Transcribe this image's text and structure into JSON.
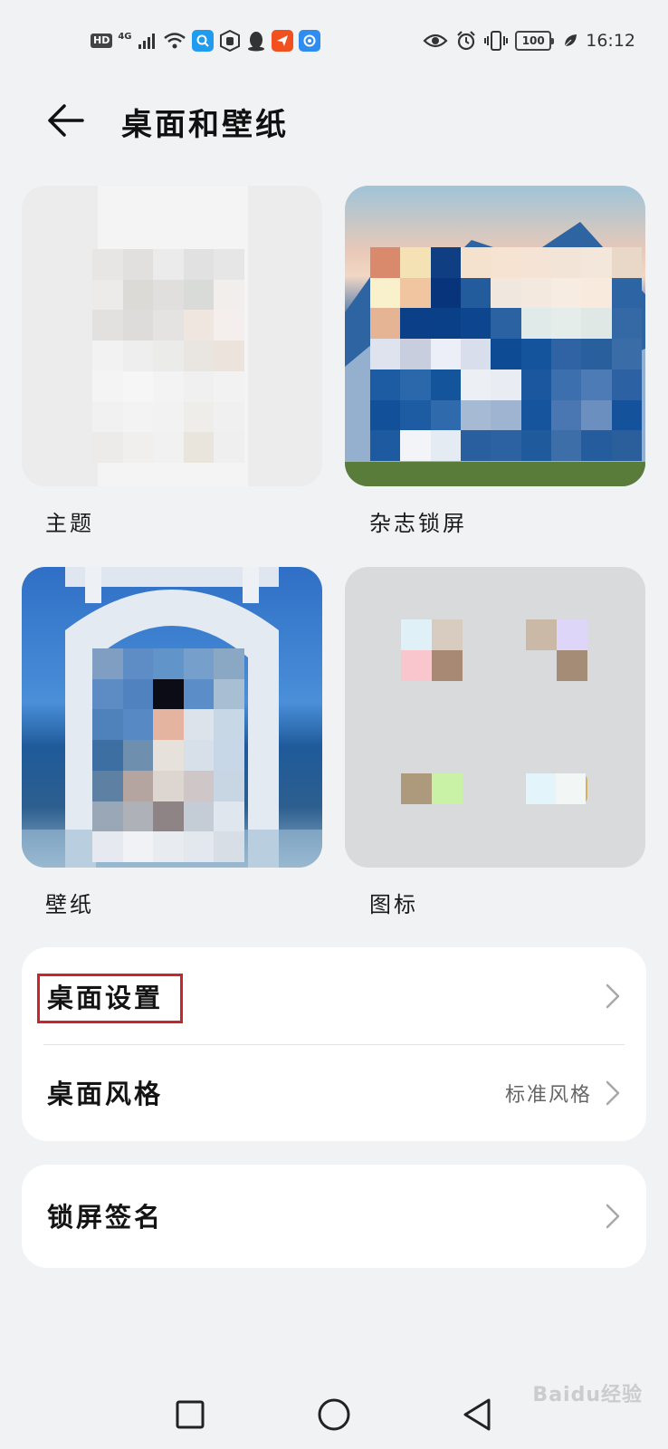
{
  "status_bar": {
    "hd": "HD",
    "network": "4G",
    "battery": "100",
    "time": "16:12",
    "left_icons": [
      "hd-icon",
      "signal-icon",
      "wifi-icon",
      "search-app-icon",
      "hand-app-icon",
      "qq-icon",
      "mail-app-icon",
      "browser-app-icon"
    ],
    "right_icons": [
      "eye-icon",
      "alarm-icon",
      "vibrate-icon",
      "battery-icon",
      "leaf-icon"
    ]
  },
  "header": {
    "title": "桌面和壁纸",
    "back_icon": "arrow-left-icon"
  },
  "tiles": [
    {
      "label": "主题"
    },
    {
      "label": "杂志锁屏"
    },
    {
      "label": "壁纸"
    },
    {
      "label": "图标"
    }
  ],
  "settings": {
    "desktop_settings": "桌面设置",
    "desktop_style": "桌面风格",
    "desktop_style_value": "标准风格",
    "lock_signature": "锁屏签名"
  },
  "nav": {
    "recent_icon": "square-icon",
    "home_icon": "circle-icon",
    "back_icon": "triangle-back-icon"
  },
  "watermark": "Baidu经验",
  "colors": {
    "background": "#f1f2f4",
    "card": "#ffffff",
    "highlight": "#c8262b"
  }
}
